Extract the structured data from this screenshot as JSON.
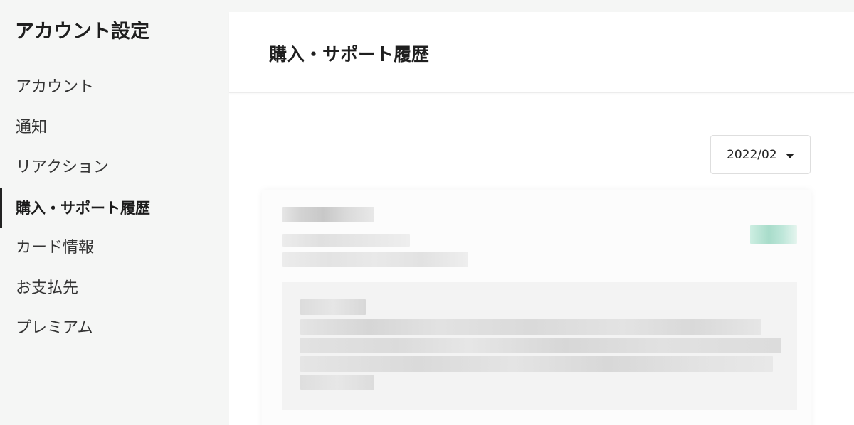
{
  "sidebar": {
    "title": "アカウント設定",
    "items": [
      {
        "label": "アカウント",
        "active": false
      },
      {
        "label": "通知",
        "active": false
      },
      {
        "label": "リアクション",
        "active": false
      },
      {
        "label": "購入・サポート履歴",
        "active": true
      },
      {
        "label": "カード情報",
        "active": false
      },
      {
        "label": "お支払先",
        "active": false
      },
      {
        "label": "プレミアム",
        "active": false
      }
    ]
  },
  "main": {
    "title": "購入・サポート履歴",
    "month_select": {
      "value": "2022/02",
      "icon": "caret-down-icon"
    }
  },
  "colors": {
    "background": "#f5f6f5",
    "panel": "#ffffff",
    "accent_badge": "#9fd8c6",
    "text": "#222222"
  }
}
